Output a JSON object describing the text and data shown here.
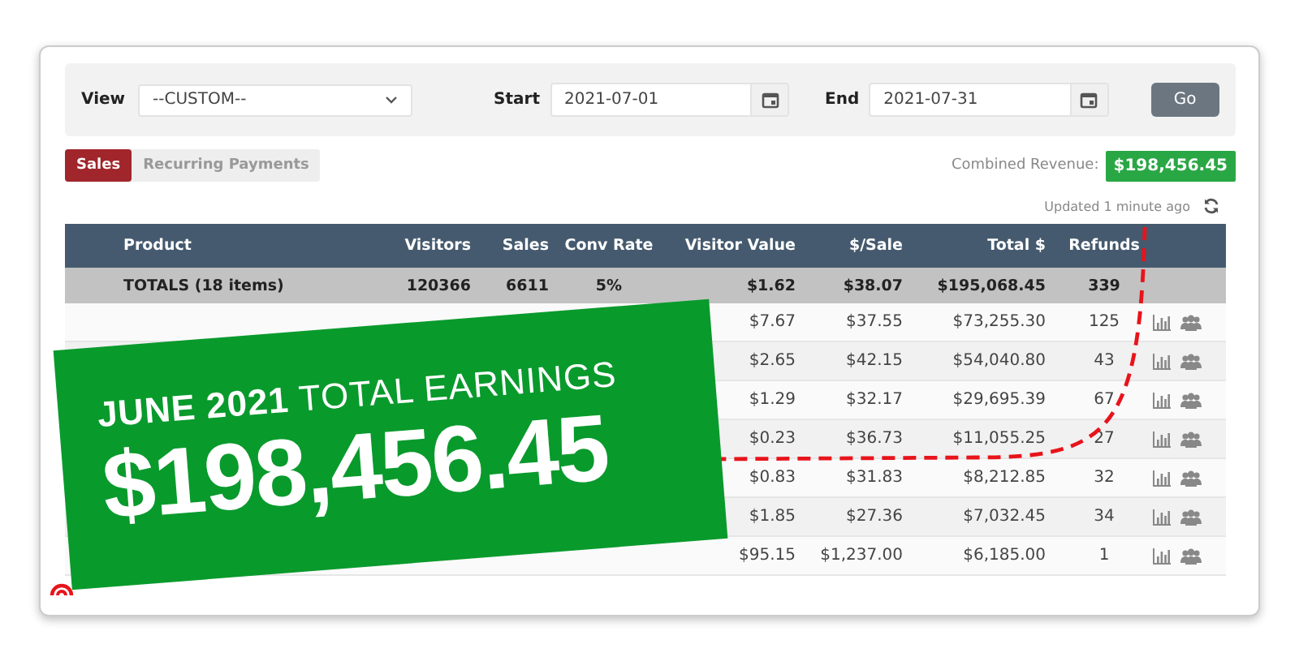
{
  "filters": {
    "view_label": "View",
    "view_value": "--CUSTOM--",
    "start_label": "Start",
    "start_value": "2021-07-01",
    "end_label": "End",
    "end_value": "2021-07-31",
    "go_button": "Go"
  },
  "tabs": [
    {
      "label": "Sales",
      "selected": true
    },
    {
      "label": "Recurring Payments",
      "selected": false
    }
  ],
  "combined_revenue": {
    "label": "Combined Revenue:",
    "value": "$198,456.45"
  },
  "updated": "Updated 1 minute ago",
  "table": {
    "columns": [
      "Product",
      "Visitors",
      "Sales",
      "Conv Rate",
      "Visitor Value",
      "$/Sale",
      "Total $",
      "Refunds"
    ],
    "totals": {
      "product": "TOTALS (18 items)",
      "visitors": "120366",
      "sales": "6611",
      "conv_rate": "5%",
      "visitor_value": "$1.62",
      "per_sale": "$38.07",
      "total": "$195,068.45",
      "refunds": "339"
    },
    "rows": [
      {
        "visitor_value": "$7.67",
        "per_sale": "$37.55",
        "total": "$73,255.30",
        "refunds": "125"
      },
      {
        "visitor_value": "$2.65",
        "per_sale": "$42.15",
        "total": "$54,040.80",
        "refunds": "43"
      },
      {
        "visitor_value": "$1.29",
        "per_sale": "$32.17",
        "total": "$29,695.39",
        "refunds": "67"
      },
      {
        "visitor_value": "$0.23",
        "per_sale": "$36.73",
        "total": "$11,055.25",
        "refunds": "27"
      },
      {
        "visitor_value": "$0.83",
        "per_sale": "$31.83",
        "total": "$8,212.85",
        "refunds": "32"
      },
      {
        "visitor_value": "$1.85",
        "per_sale": "$27.36",
        "total": "$7,032.45",
        "refunds": "34"
      },
      {
        "visitor_value": "$95.15",
        "per_sale": "$1,237.00",
        "total": "$6,185.00",
        "refunds": "1"
      }
    ]
  },
  "banner": {
    "title": "**JUNE 2021** TOTAL EARNINGS",
    "amount": "$198,456.45"
  }
}
